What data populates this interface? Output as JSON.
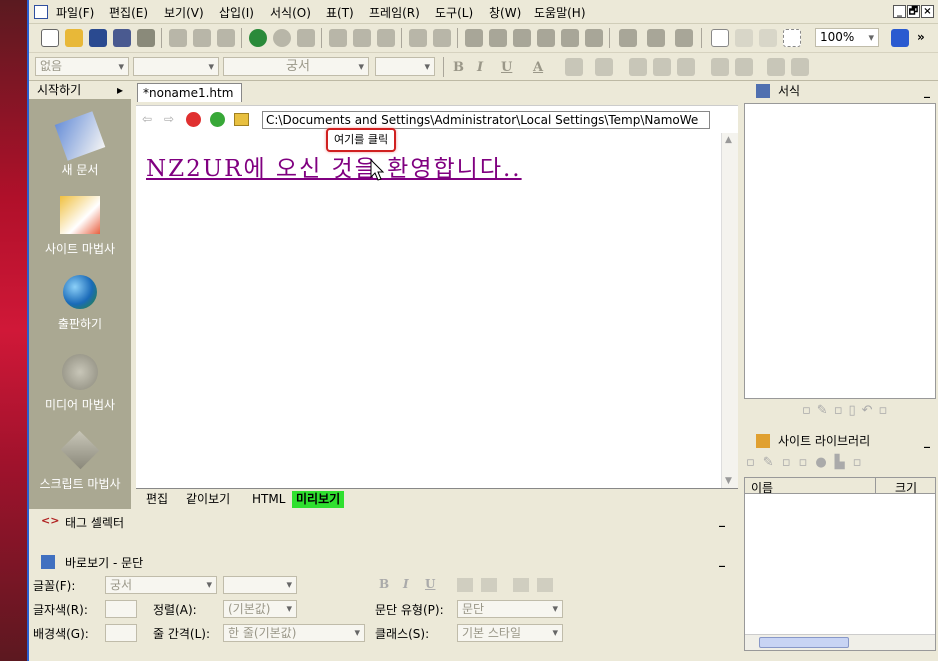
{
  "menubar": {
    "items": [
      "파일(F)",
      "편집(E)",
      "보기(V)",
      "삽입(I)",
      "서식(O)",
      "표(T)",
      "프레임(R)",
      "도구(L)",
      "창(W)",
      "도움말(H)"
    ],
    "window_controls": [
      "_",
      "🗗",
      "×"
    ]
  },
  "toolbar": {
    "zoom": "100%",
    "overflow": "»"
  },
  "format_bar": {
    "style_value": "없음",
    "font_value": "궁서",
    "bold": "B",
    "italic": "I",
    "underline": "U",
    "font_color": "A"
  },
  "left_panel": {
    "header": "시작하기",
    "arrow": "▸",
    "items": [
      "새 문서",
      "사이트 마법사",
      "출판하기",
      "미디어 마법사",
      "스크립트 마법사"
    ]
  },
  "document": {
    "tab_label": "*noname1.htm",
    "address": "C:\\Documents and Settings\\Administrator\\Local Settings\\Temp\\NamoWe",
    "heading": "NZ2UR에 오신 것을 환영합니다..",
    "tooltip": "여기를 클릭"
  },
  "view_tabs": [
    "편집",
    "같이보기",
    "HTML",
    "미리보기"
  ],
  "tag_selector": {
    "label": "태그 셀렉터"
  },
  "properties": {
    "title": "바로보기 - 문단",
    "font_label": "글꼴(F):",
    "font_value": "궁서",
    "bold": "B",
    "italic": "I",
    "underline": "U",
    "color_label": "글자색(R):",
    "align_label": "정렬(A):",
    "align_value": "(기본값)",
    "para_type_label": "문단 유형(P):",
    "para_type_value": "문단",
    "bg_label": "배경색(G):",
    "line_spacing_label": "줄 간격(L):",
    "line_spacing_value": "한 줄(기본값)",
    "class_label": "클래스(S):",
    "class_value": "기본 스타일"
  },
  "right_panel": {
    "format_title": "서식",
    "library_title": "사이트 라이브러리",
    "col_name": "이름",
    "col_size": "크기",
    "minimize": "_"
  }
}
